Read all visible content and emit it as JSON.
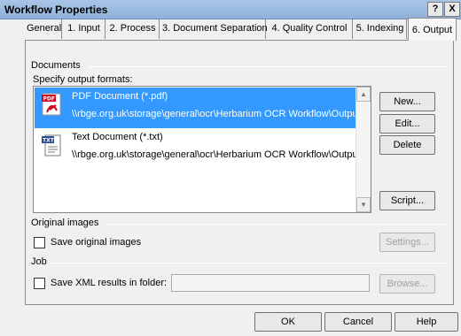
{
  "window": {
    "title": "Workflow Properties",
    "help_glyph": "?",
    "close_glyph": "X"
  },
  "tabs": [
    {
      "label": "General"
    },
    {
      "label": "1. Input"
    },
    {
      "label": "2. Process"
    },
    {
      "label": "3. Document Separation"
    },
    {
      "label": "4. Quality Control"
    },
    {
      "label": "5. Indexing"
    },
    {
      "label": "6. Output",
      "active": true
    }
  ],
  "documents": {
    "group_label": "Documents",
    "formats_label": "Specify output formats:",
    "formats": [
      {
        "name": "PDF Document (*.pdf)",
        "path": "\\\\rbge.org.uk\\storage\\general\\ocr\\Herbarium OCR Workflow\\Output F",
        "icon": "pdf-icon",
        "selected": true
      },
      {
        "name": "Text Document (*.txt)",
        "path": "\\\\rbge.org.uk\\storage\\general\\ocr\\Herbarium OCR Workflow\\Output F",
        "icon": "txt-icon",
        "selected": false
      }
    ],
    "buttons": {
      "new": "New...",
      "edit": "Edit...",
      "delete": "Delete",
      "script": "Script..."
    }
  },
  "original_images": {
    "group_label": "Original images",
    "save_label": "Save original images",
    "save_checked": false,
    "settings_button": "Settings..."
  },
  "job": {
    "group_label": "Job",
    "save_xml_label": "Save XML results in folder:",
    "save_xml_checked": false,
    "folder_value": "",
    "browse_button": "Browse..."
  },
  "footer": {
    "ok": "OK",
    "cancel": "Cancel",
    "help": "Help"
  },
  "colors": {
    "selection": "#3399ff",
    "title_bar": "#a9c5e6",
    "dialog_bg": "#f0f0f0"
  }
}
